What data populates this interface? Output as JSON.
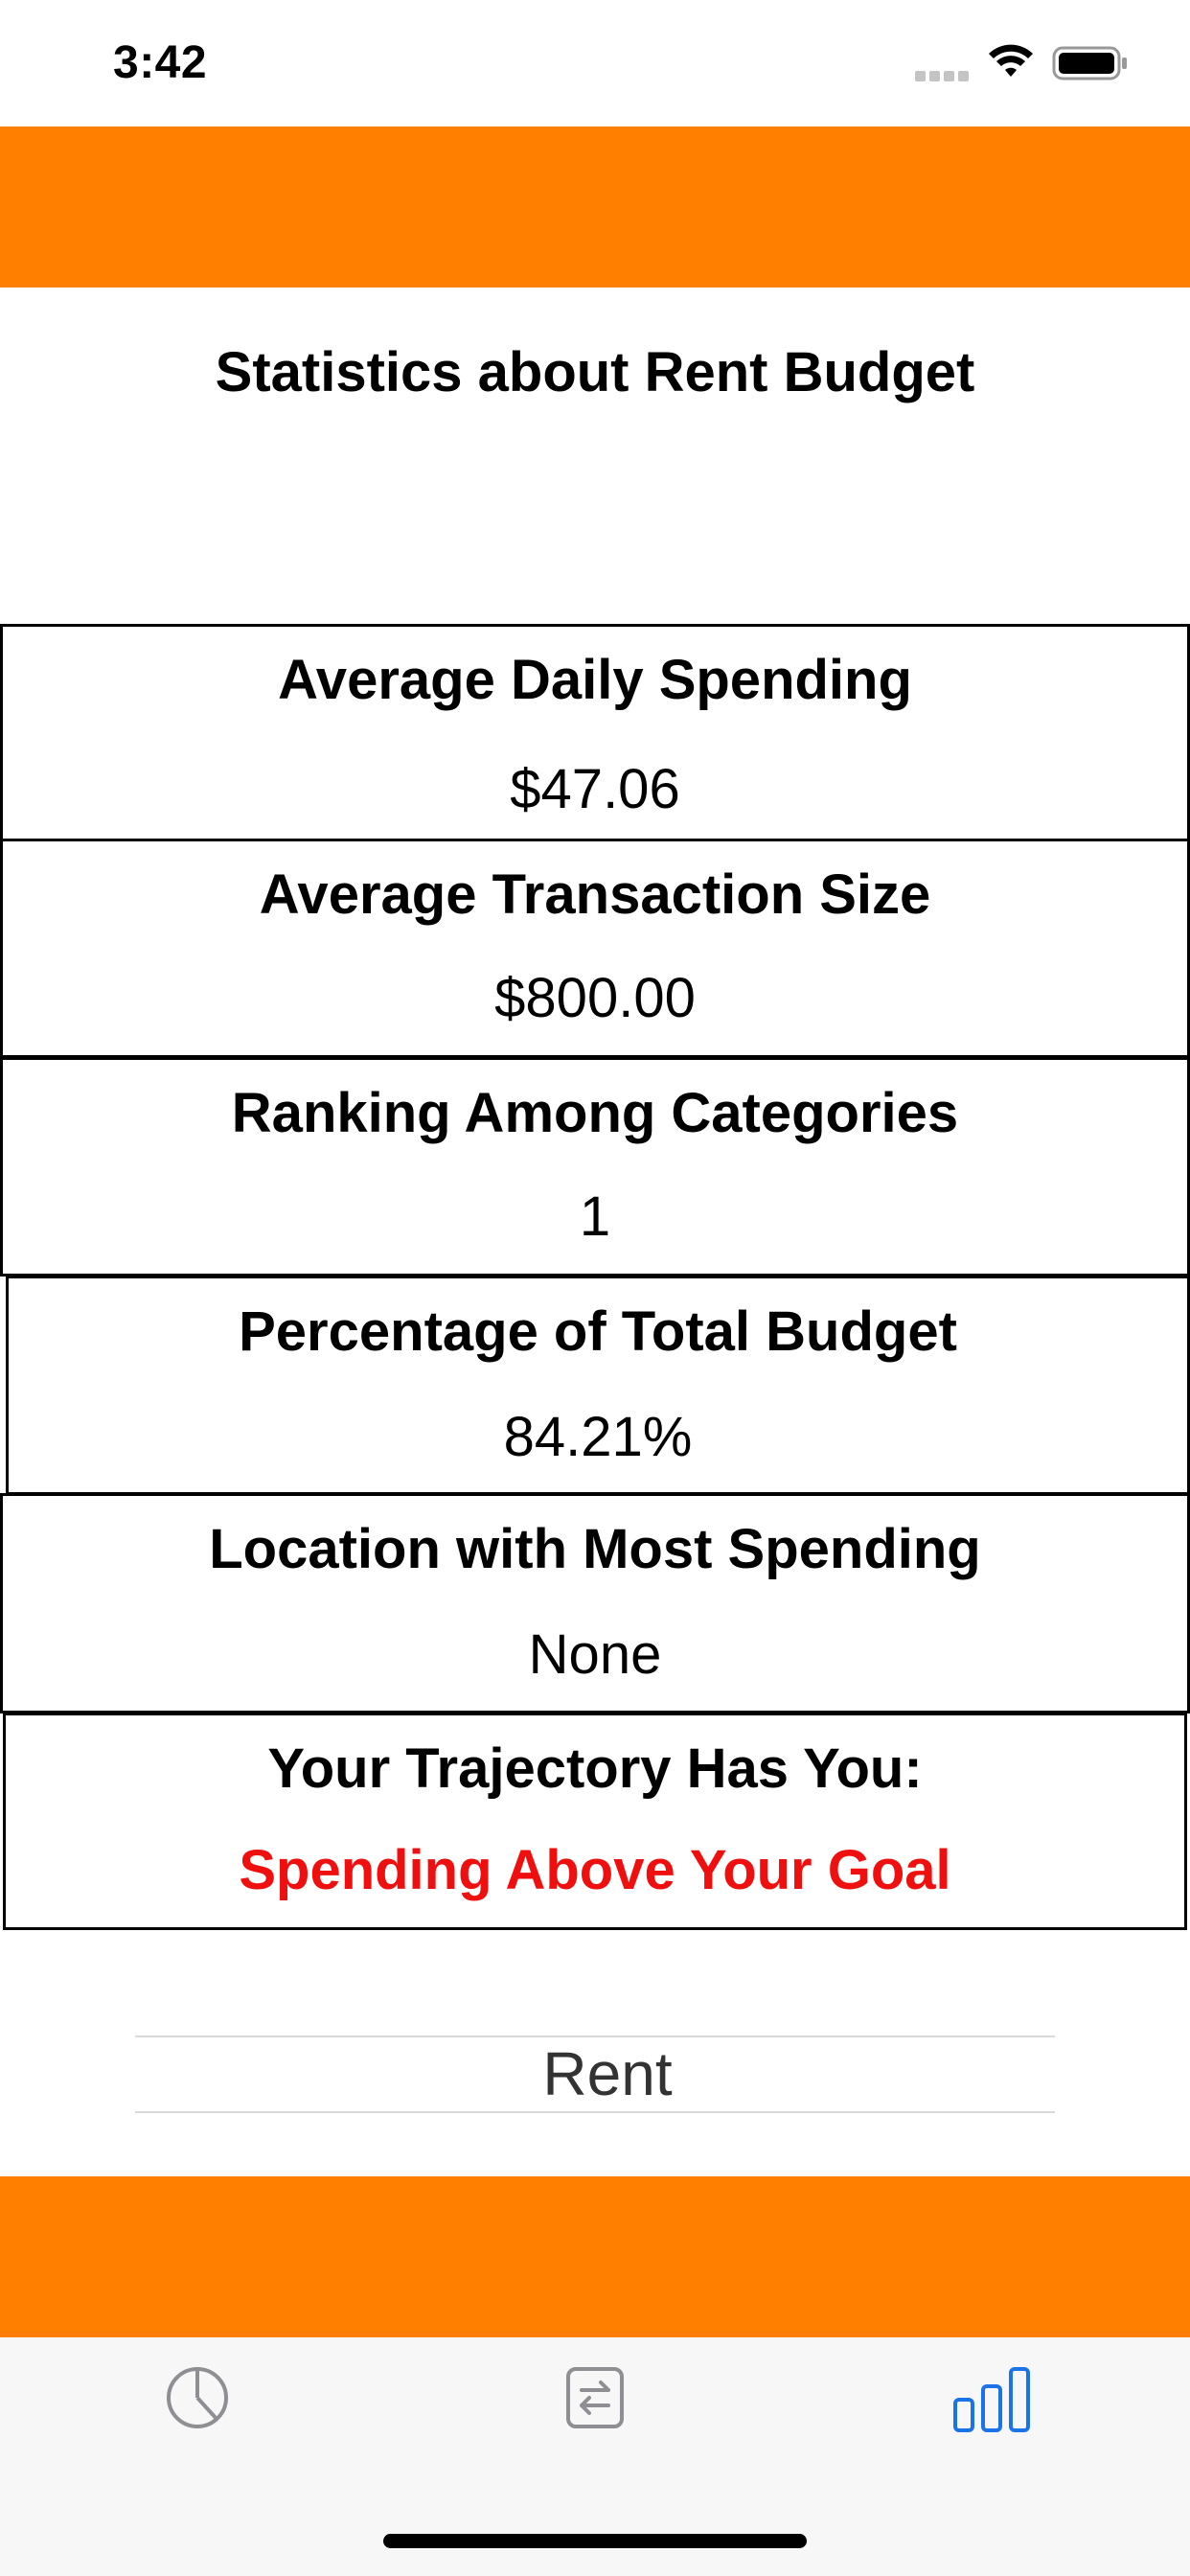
{
  "status_bar": {
    "time": "3:42",
    "signal_icon": "signal-dots-icon",
    "wifi_icon": "wifi-icon",
    "battery_icon": "battery-icon"
  },
  "page": {
    "title": "Statistics about Rent Budget"
  },
  "stats": [
    {
      "label": "Average Daily Spending",
      "value": "$47.06"
    },
    {
      "label": "Average Transaction Size",
      "value": "$800.00"
    },
    {
      "label": "Ranking Among Categories",
      "value": "1"
    },
    {
      "label": "Percentage of Total Budget",
      "value": "84.21%"
    },
    {
      "label": "Location with Most Spending",
      "value": "None"
    },
    {
      "label": "Your Trajectory Has You:",
      "value": "Spending Above Your Goal"
    }
  ],
  "picker": {
    "selected": "Rent"
  },
  "tab_bar": {
    "tabs": [
      {
        "icon": "pie-chart-icon",
        "active": false
      },
      {
        "icon": "transfer-icon",
        "active": false
      },
      {
        "icon": "bar-chart-icon",
        "active": true
      }
    ]
  },
  "colors": {
    "accent": "#ff8000",
    "alert": "#f00f0f",
    "tab_active": "#1a73e8",
    "tab_inactive": "#8e8e93"
  }
}
